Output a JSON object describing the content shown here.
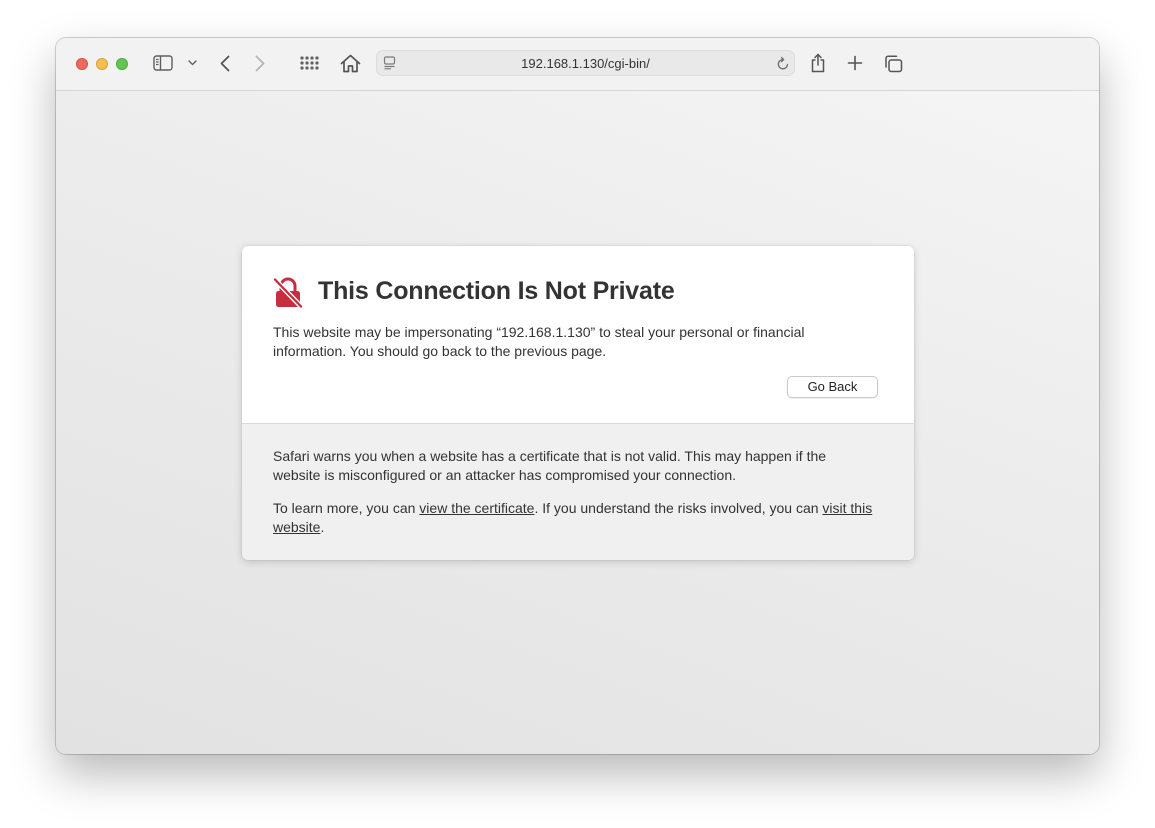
{
  "browser": {
    "url": "192.168.1.130/cgi-bin/",
    "icons": {
      "sidebar": "sidebar-icon",
      "sidebar_menu": "chevron-down-icon",
      "back": "chevron-left-icon",
      "forward": "chevron-right-icon",
      "tab_overview": "grid-icon",
      "home": "home-icon",
      "page_menu": "page-menu-icon",
      "reload": "reload-icon",
      "share": "share-icon",
      "new_tab": "plus-icon",
      "tabs": "tabs-icon"
    }
  },
  "warning": {
    "title": "This Connection Is Not Private",
    "message": "This website may be impersonating “192.168.1.130” to steal your personal or financial information. You should go back to the previous page.",
    "go_back_label": "Go Back",
    "details": "Safari warns you when a website has a certificate that is not valid. This may happen if the website is misconfigured or an attacker has compromised your connection.",
    "learn_prefix": "To learn more, you can ",
    "view_certificate_link": "view the certificate",
    "learn_middle": ". If you understand the risks involved, you can ",
    "visit_link": "visit this website",
    "learn_suffix": ".",
    "icon": "broken-lock-icon"
  },
  "colors": {
    "lock_red": "#c62e3f",
    "text": "#333333"
  }
}
